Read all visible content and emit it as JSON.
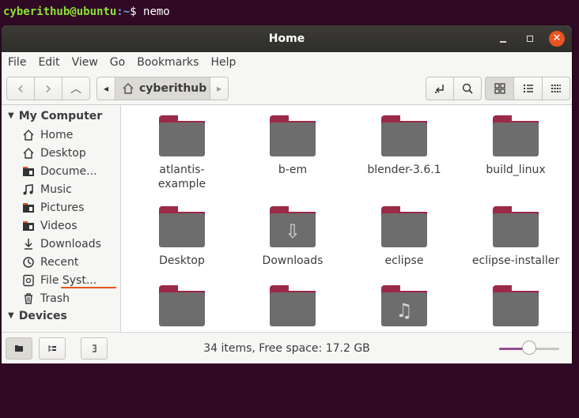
{
  "terminal": {
    "user_host": "cyberithub@ubuntu",
    "path": ":~",
    "prompt": "$ ",
    "command": "nemo"
  },
  "window": {
    "title": "Home",
    "close_glyph": "✕"
  },
  "menu": [
    "File",
    "Edit",
    "View",
    "Go",
    "Bookmarks",
    "Help"
  ],
  "toolbar": {
    "back_icon": "‹",
    "forward_icon": "›",
    "up_icon": "︿",
    "path_left_icon": "◂",
    "path_right_icon": "▸",
    "current_folder": "cyberithub"
  },
  "sidebar": {
    "sections": [
      {
        "label": "My Computer",
        "items": [
          {
            "label": "Home",
            "icon": "home-icon"
          },
          {
            "label": "Desktop",
            "icon": "home-icon"
          },
          {
            "label": "Docume...",
            "icon": "folder-icon"
          },
          {
            "label": "Music",
            "icon": "music-icon"
          },
          {
            "label": "Pictures",
            "icon": "folder-icon"
          },
          {
            "label": "Videos",
            "icon": "folder-icon"
          },
          {
            "label": "Downloads",
            "icon": "download-icon"
          },
          {
            "label": "Recent",
            "icon": "clock-icon"
          },
          {
            "label": "File Syst...",
            "icon": "drive-icon"
          },
          {
            "label": "Trash",
            "icon": "trash-icon"
          }
        ]
      },
      {
        "label": "Devices",
        "items": []
      }
    ]
  },
  "files": [
    {
      "name": "atlantis-\nexample",
      "emblem": ""
    },
    {
      "name": "b-em",
      "emblem": ""
    },
    {
      "name": "blender-3.6.1",
      "emblem": ""
    },
    {
      "name": "build_linux",
      "emblem": ""
    },
    {
      "name": "Desktop",
      "emblem": ""
    },
    {
      "name": "Downloads",
      "emblem": "⇩"
    },
    {
      "name": "eclipse",
      "emblem": ""
    },
    {
      "name": "eclipse-installer",
      "emblem": ""
    },
    {
      "name": "",
      "emblem": ""
    },
    {
      "name": "",
      "emblem": ""
    },
    {
      "name": "",
      "emblem": "♫"
    },
    {
      "name": "",
      "emblem": ""
    }
  ],
  "status": {
    "text": "34 items, Free space: 17.2 GB",
    "zoom_level": 0.5
  },
  "colors": {
    "accent": "#e95420",
    "folder_tab": "#9b2948",
    "folder_body": "#6d6d6d",
    "terminal_bg": "#300a24"
  }
}
